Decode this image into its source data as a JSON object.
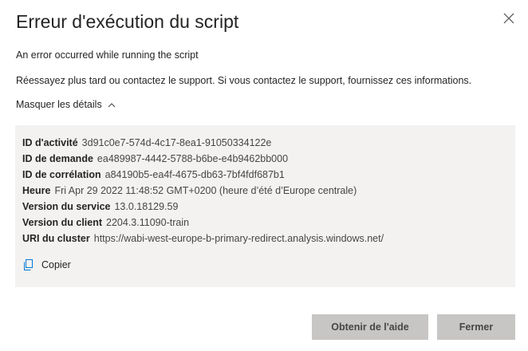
{
  "dialog": {
    "title": "Erreur d'exécution du script",
    "message": "An error occurred while running the script",
    "instructions": "Réessayez plus tard ou contactez le support. Si vous contactez le support, fournissez ces informations.",
    "toggle_label": "Masquer les détails",
    "details": [
      {
        "label": "ID d'activité",
        "value": "3d91c0e7-574d-4c17-8ea1-91050334122e"
      },
      {
        "label": "ID de demande",
        "value": "ea489987-4442-5788-b6be-e4b9462bb000"
      },
      {
        "label": "ID de corrélation",
        "value": "a84190b5-ea4f-4675-db63-7bf4fdf687b1"
      },
      {
        "label": "Heure",
        "value": "Fri Apr 29 2022 11:48:52 GMT+0200 (heure d’été d’Europe centrale)"
      },
      {
        "label": "Version du service",
        "value": "13.0.18129.59"
      },
      {
        "label": "Version du client",
        "value": "2204.3.11090-train"
      },
      {
        "label": "URI du cluster",
        "value": "https://wabi-west-europe-b-primary-redirect.analysis.windows.net/"
      }
    ],
    "copy_label": "Copier",
    "buttons": {
      "help": "Obtenir de l'aide",
      "close": "Fermer"
    },
    "icons": {
      "close": "close-icon",
      "toggle": "chevron-up-icon",
      "copy": "copy-icon"
    },
    "colors": {
      "details_bg": "#f3f2f1",
      "button_bg": "#c8c6c4",
      "icon_accent": "#0078d4"
    }
  }
}
